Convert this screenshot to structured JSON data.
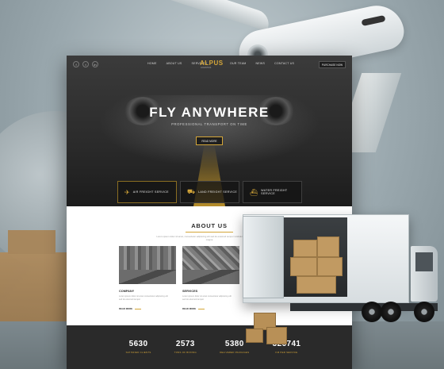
{
  "site": {
    "social": [
      "f",
      "t",
      "in"
    ],
    "logo": "ALPUS",
    "logo_sub": "LOGISTICS",
    "nav_left": [
      "HOME",
      "ABOUT US",
      "SERVICES"
    ],
    "nav_right": [
      "OUR TEAM",
      "NEWS",
      "CONTACT US"
    ],
    "nav_cta": "PURCHASE NOW",
    "hero": {
      "title": "FLY ANYWHERE",
      "subtitle": "PROFESSIONAL TRANSPORT ON TIME",
      "button": "READ MORE"
    },
    "services": [
      {
        "icon": "plane-icon",
        "glyph": "✈",
        "label": "AIR FREIGHT SERVICE"
      },
      {
        "icon": "truck-icon",
        "glyph": "⛟",
        "label": "LAND FREIGHT SERVICE"
      },
      {
        "icon": "ship-icon",
        "glyph": "⛴",
        "label": "WATER FREIGHT SERVICE"
      }
    ],
    "about": {
      "title": "ABOUT US",
      "text": "Lorem ipsum dolor sit amet, consectetur adipiscing elit sed do eiusmod tempor incididunt ut labore et dolore magna"
    },
    "cards": [
      {
        "title": "COMPANY",
        "text": "Lorem ipsum dolor sit amet consectetur adipiscing elit sed do eiusmod tempor",
        "more": "READ MORE"
      },
      {
        "title": "SERVICES",
        "text": "Lorem ipsum dolor sit amet consectetur adipiscing elit sed do eiusmod tempor",
        "more": "READ MORE"
      }
    ],
    "stats": [
      {
        "number": "5630",
        "label": "SATISFIED CLIENTS"
      },
      {
        "number": "2573",
        "label": "TONS OF BOXING"
      },
      {
        "number": "5380",
        "label": "DELIVERED PACKAGES"
      },
      {
        "number": "326741",
        "label": "KM PER SERVICE"
      }
    ]
  },
  "colors": {
    "accent": "#d4a639",
    "dark": "#2a2a2a",
    "background": "#9aa8ae"
  }
}
